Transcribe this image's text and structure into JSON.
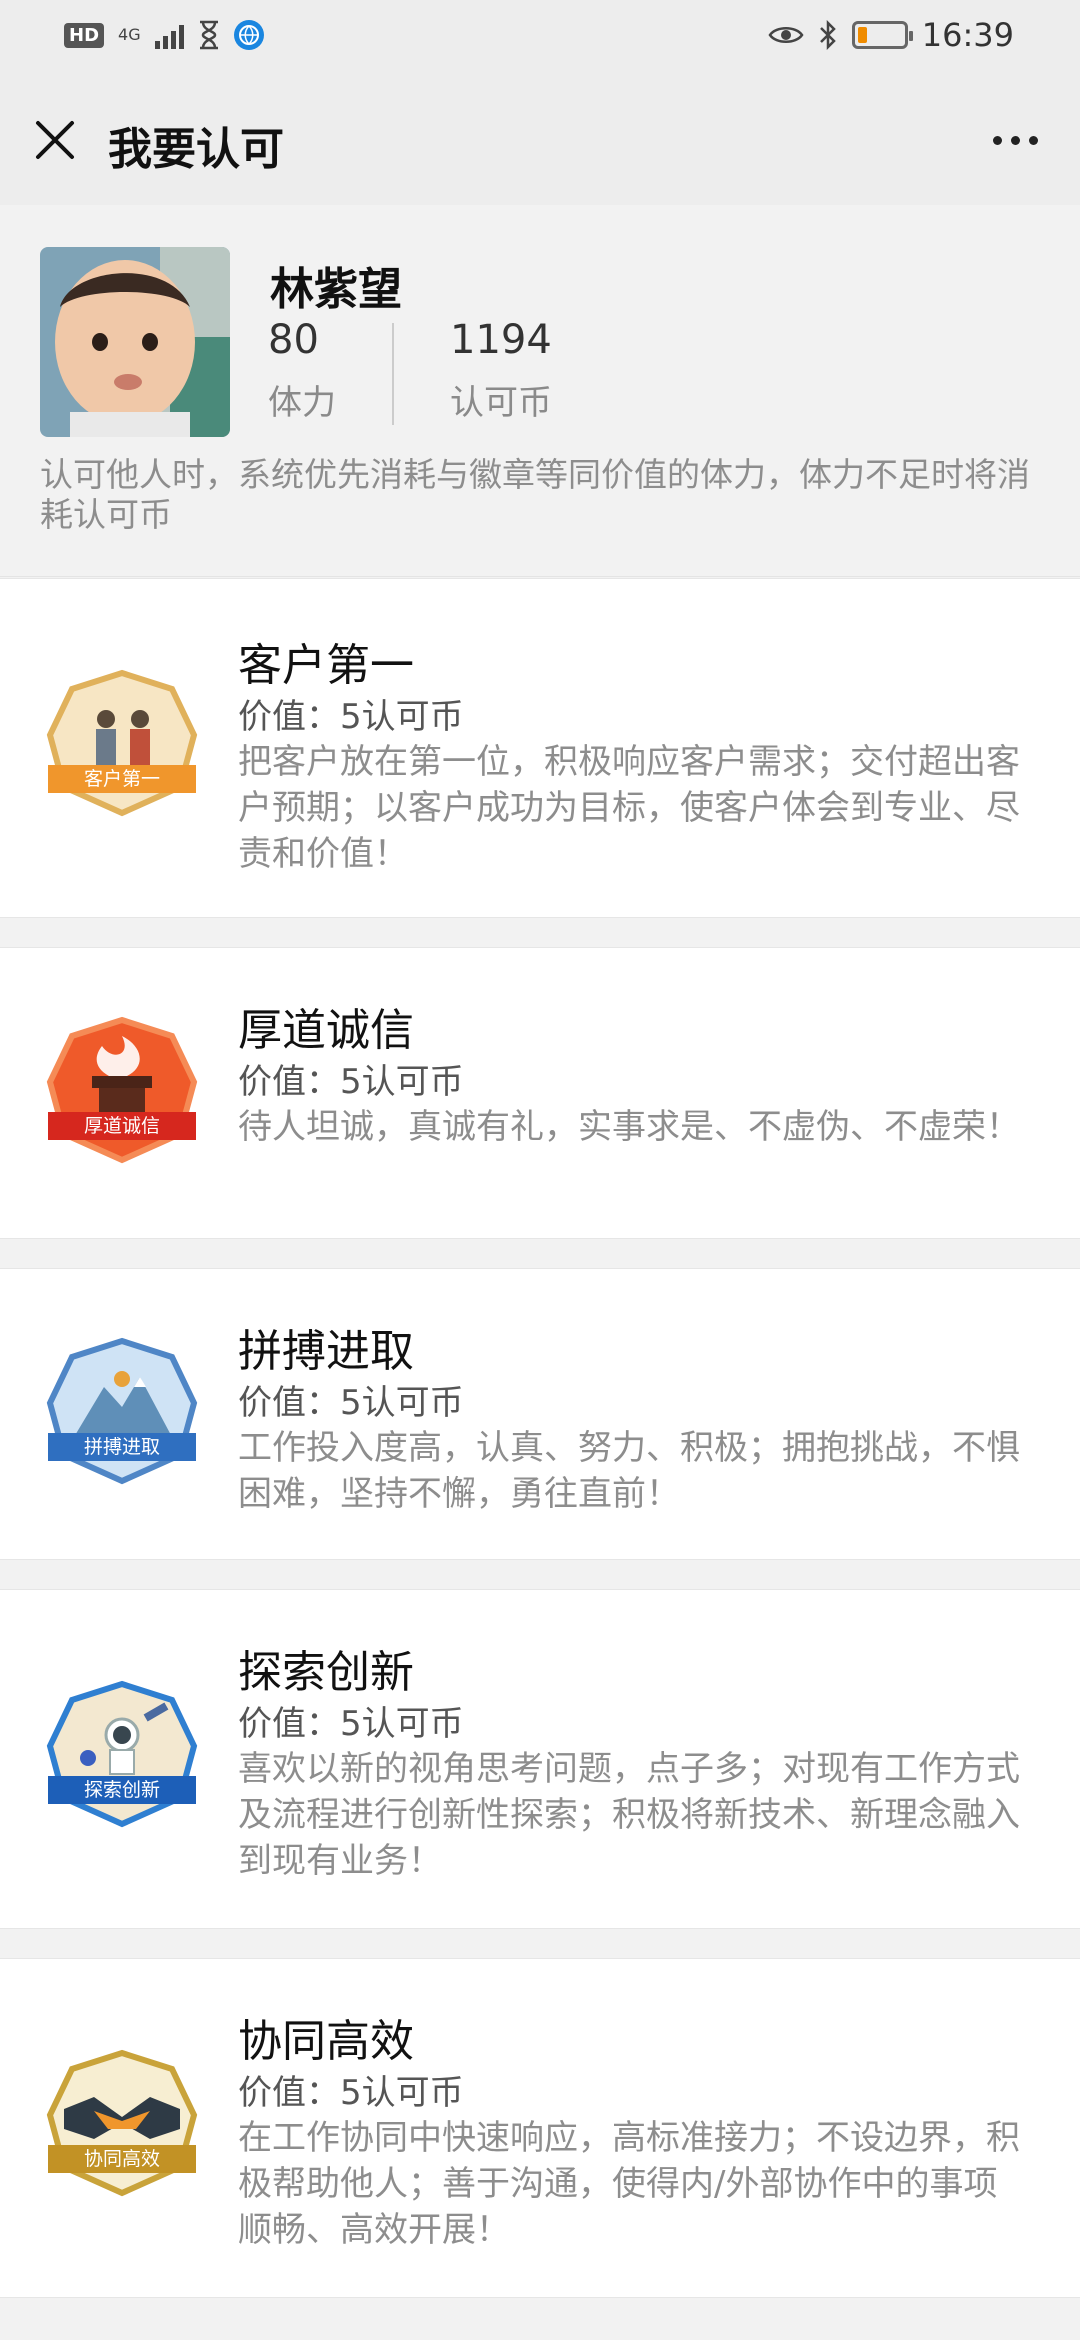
{
  "status_bar": {
    "hd": "HD",
    "network": "4G",
    "time": "16:39",
    "battery_level": 0.2
  },
  "header": {
    "title": "我要认可"
  },
  "profile": {
    "name": "林紫望",
    "stamina_value": "80",
    "stamina_label": "体力",
    "coins_value": "1194",
    "coins_label": "认可币",
    "note": "认可他人时，系统优先消耗与徽章等同价值的体力，体力不足时将消耗认可币"
  },
  "values": [
    {
      "title": "客户第一",
      "value": "价值：5认可币",
      "desc": "把客户放在第一位，积极响应客户需求；交付超出客户预期；以客户成功为目标，使客户体会到专业、尽责和价值！",
      "badge_label": "客户第一",
      "badge_color": "#e0b15b",
      "ribbon_color": "#f0962c"
    },
    {
      "title": "厚道诚信",
      "value": "价值：5认可币",
      "desc": "待人坦诚，真诚有礼，实事求是、不虚伪、不虚荣！",
      "badge_label": "厚道诚信",
      "badge_color": "#ef5a2a",
      "ribbon_color": "#d6271e"
    },
    {
      "title": "拼搏进取",
      "value": "价值：5认可币",
      "desc": "工作投入度高，认真、努力、积极；拥抱挑战，不惧困难，坚持不懈，勇往直前！",
      "badge_label": "拼搏进取",
      "badge_color": "#4f86c6",
      "ribbon_color": "#2f6fc0"
    },
    {
      "title": "探索创新",
      "value": "价值：5认可币",
      "desc": "喜欢以新的视角思考问题，点子多；对现有工作方式及流程进行创新性探索；积极将新技术、新理念融入到现有业务！",
      "badge_label": "探索创新",
      "badge_color": "#2f7fd1",
      "ribbon_color": "#1d5fb8"
    },
    {
      "title": "协同高效",
      "value": "价值：5认可币",
      "desc": "在工作协同中快速响应，高标准接力；不设边界，积极帮助他人；善于沟通，使得内/外部协作中的事项顺畅、高效开展！",
      "badge_label": "协同高效",
      "badge_color": "#c9a33a",
      "ribbon_color": "#c29225"
    }
  ]
}
